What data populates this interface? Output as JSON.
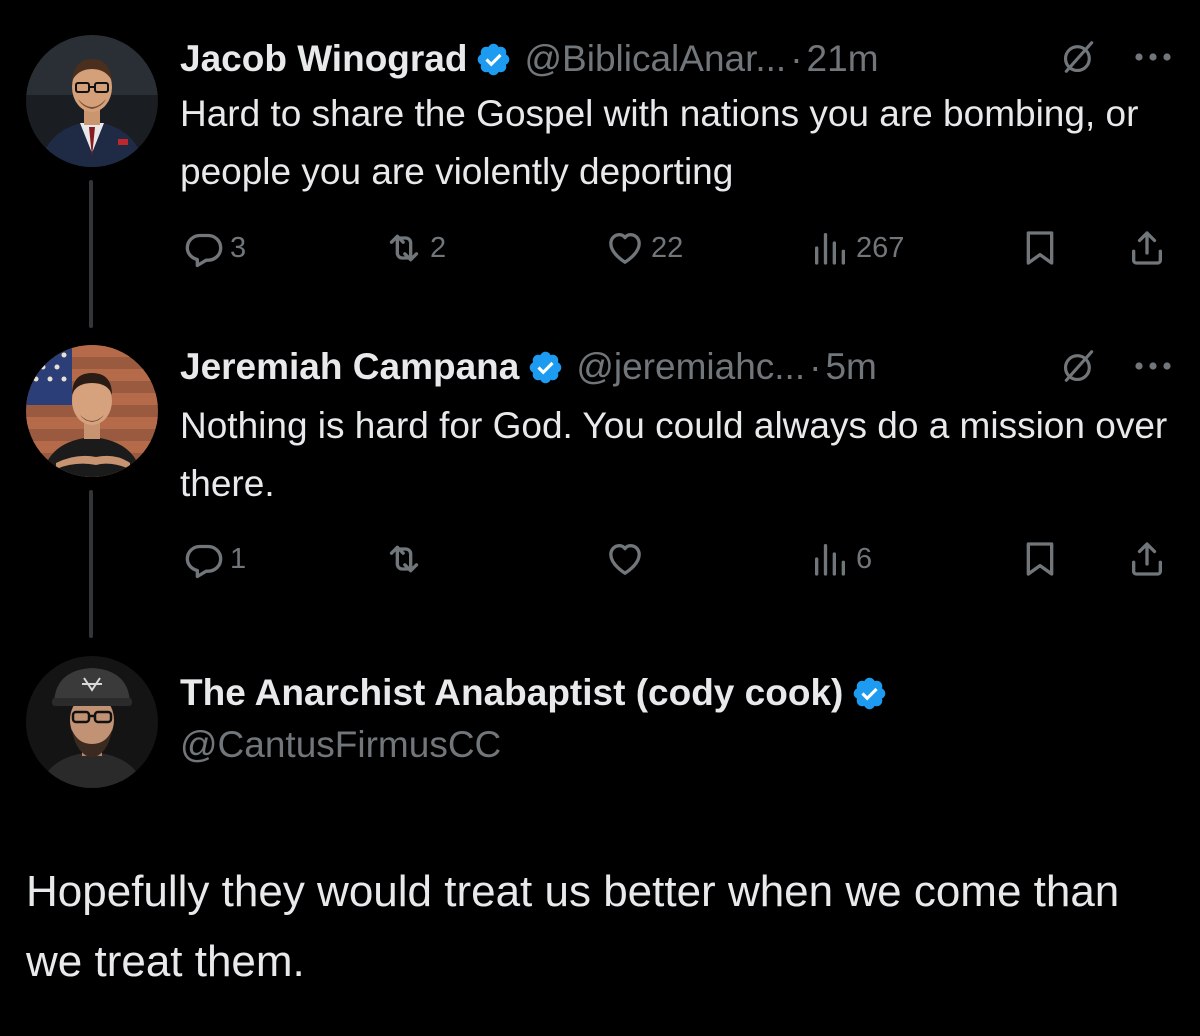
{
  "tweets": [
    {
      "display_name": "Jacob Winograd",
      "handle": "@BiblicalAnar...",
      "separator": "·",
      "time": "21m",
      "text": "Hard to share the Gospel with nations you are bombing, or people you are violently deporting",
      "actions": {
        "reply_count": "3",
        "retweet_count": "2",
        "like_count": "22",
        "view_count": "267"
      }
    },
    {
      "display_name": "Jeremiah Campana",
      "handle": "@jeremiahc...",
      "separator": "·",
      "time": "5m",
      "text": "Nothing is hard for God. You could always do a mission over there.",
      "actions": {
        "reply_count": "1",
        "retweet_count": "",
        "like_count": "",
        "view_count": "6"
      }
    }
  ],
  "main_tweet": {
    "display_name": "The Anarchist Anabaptist (cody cook)",
    "handle": "@CantusFirmusCC",
    "text": "Hopefully they would treat us better when we come than we treat them."
  },
  "icons": {
    "verified": "verified-badge-icon",
    "grok": "grok-icon",
    "more": "more-icon",
    "reply": "reply-icon",
    "retweet": "retweet-icon",
    "like": "like-icon",
    "views": "views-icon",
    "bookmark": "bookmark-icon",
    "share": "share-icon"
  },
  "colors": {
    "background": "#000000",
    "text_primary": "#e7e9ea",
    "text_secondary": "#71767b",
    "verified_blue": "#1d9bf0",
    "thread_line": "#333639"
  }
}
